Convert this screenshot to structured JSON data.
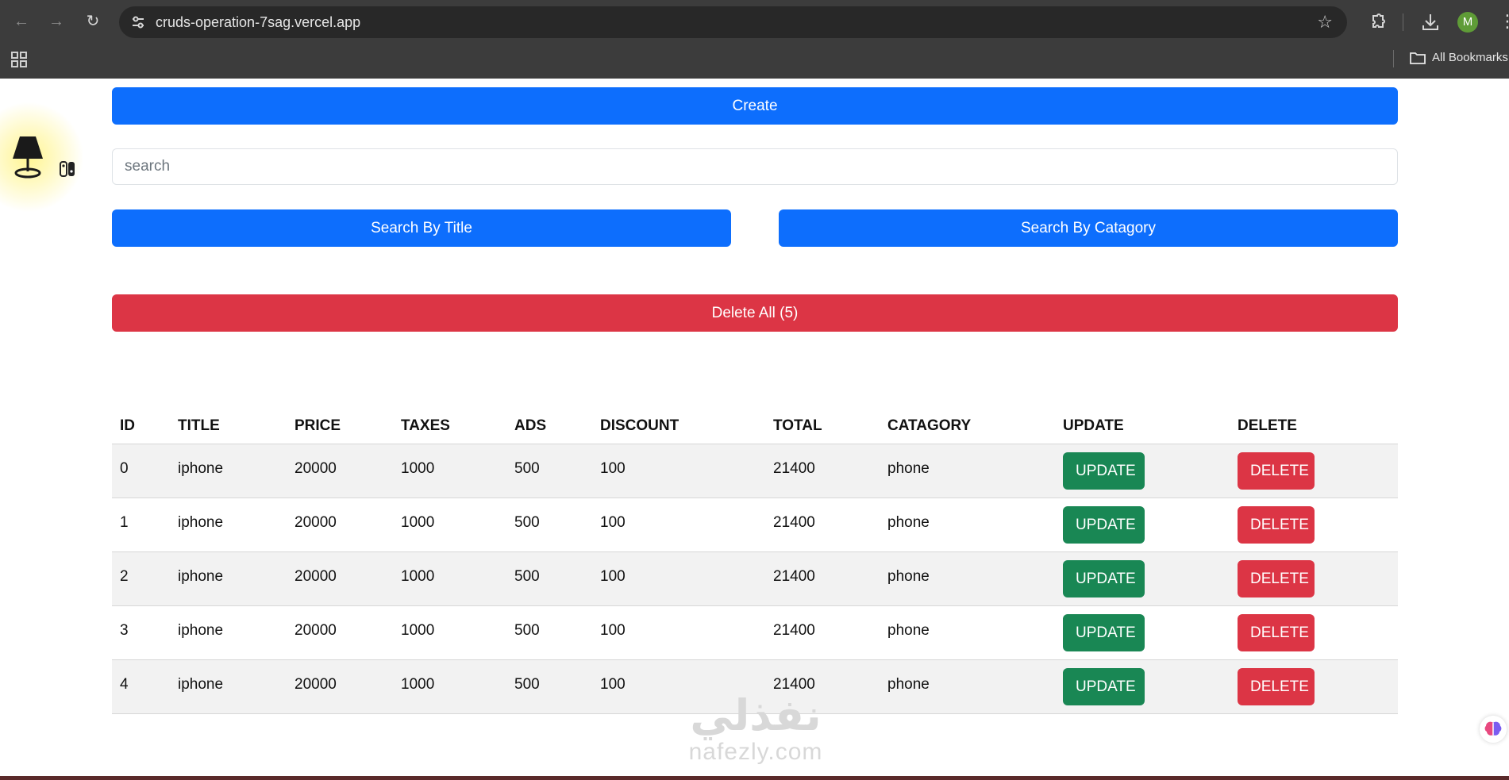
{
  "browser": {
    "url": "cruds-operation-7sag.vercel.app",
    "profile_initial": "M",
    "bookmarks_label": "All Bookmarks"
  },
  "page": {
    "create_label": "Create",
    "search_placeholder": "search",
    "search_title_label": "Search By Title",
    "search_category_label": "Search By Catagory",
    "delete_all_label": "Delete All (5)"
  },
  "table": {
    "headers": [
      "ID",
      "TITLE",
      "PRICE",
      "TAXES",
      "ADS",
      "DISCOUNT",
      "TOTAL",
      "CATAGORY",
      "UPDATE",
      "DELETE"
    ],
    "rows": [
      {
        "id": "0",
        "title": "iphone",
        "price": "20000",
        "taxes": "1000",
        "ads": "500",
        "discount": "100",
        "total": "21400",
        "category": "phone",
        "update": "UPDATE",
        "delete": "DELETE"
      },
      {
        "id": "1",
        "title": "iphone",
        "price": "20000",
        "taxes": "1000",
        "ads": "500",
        "discount": "100",
        "total": "21400",
        "category": "phone",
        "update": "UPDATE",
        "delete": "DELETE"
      },
      {
        "id": "2",
        "title": "iphone",
        "price": "20000",
        "taxes": "1000",
        "ads": "500",
        "discount": "100",
        "total": "21400",
        "category": "phone",
        "update": "UPDATE",
        "delete": "DELETE"
      },
      {
        "id": "3",
        "title": "iphone",
        "price": "20000",
        "taxes": "1000",
        "ads": "500",
        "discount": "100",
        "total": "21400",
        "category": "phone",
        "update": "UPDATE",
        "delete": "DELETE"
      },
      {
        "id": "4",
        "title": "iphone",
        "price": "20000",
        "taxes": "1000",
        "ads": "500",
        "discount": "100",
        "total": "21400",
        "category": "phone",
        "update": "UPDATE",
        "delete": "DELETE"
      }
    ]
  },
  "watermark": {
    "arabic": "نفذلي",
    "latin": "nafezly.com"
  },
  "colors": {
    "primary": "#0d6efd",
    "danger": "#dc3545",
    "success": "#198754",
    "chrome_bg": "#3c3c3c",
    "profile": "#5f9c37"
  },
  "icons": [
    "back-arrow-icon",
    "forward-arrow-icon",
    "reload-icon",
    "site-settings-icon",
    "bookmark-star-icon",
    "extensions-icon",
    "download-icon",
    "more-menu-icon",
    "apps-grid-icon",
    "folder-icon",
    "lamp-icon",
    "theme-switch-icon",
    "brain-icon"
  ]
}
